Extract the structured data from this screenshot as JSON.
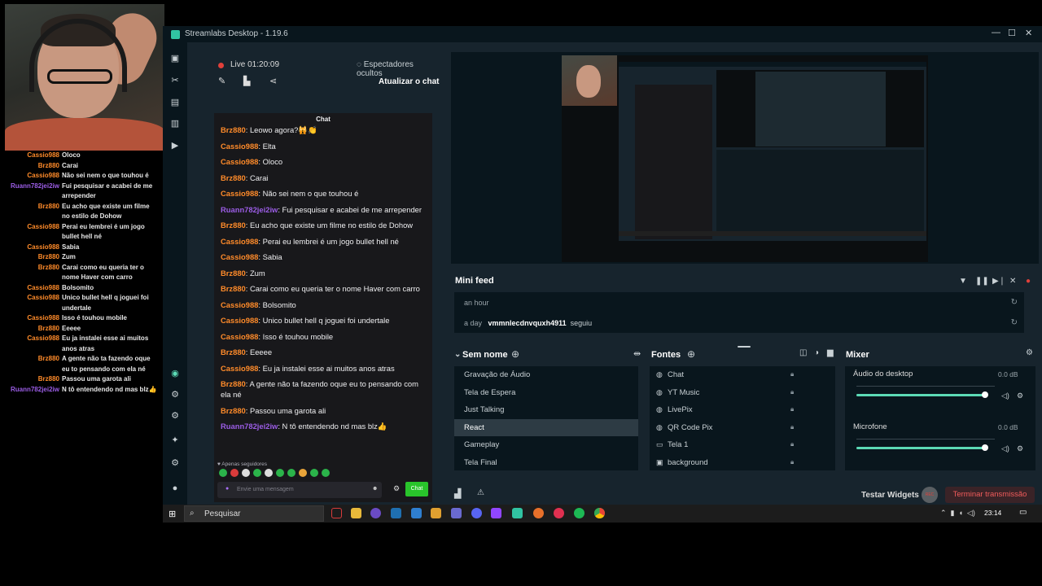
{
  "colors": {
    "bg": "#17242d",
    "dark": "#09161d",
    "accent": "#31c3a2",
    "live": "#e0403a",
    "send": "#29c42b",
    "username_orange": "#ff8b2a",
    "username_purple": "#9b5de5"
  },
  "window": {
    "title": "Streamlabs Desktop - 1.19.6",
    "minimize": "—",
    "maximize": "☐",
    "close": "✕"
  },
  "sidenav": [
    "window-icon",
    "tools-icon",
    "store-icon",
    "layout-icon",
    "play-icon",
    "theme-icon",
    "settings-icon",
    "account-icon"
  ],
  "live": {
    "status": "Live 01:20:09",
    "viewers_hidden": "Espectadores ocultos",
    "refresh_chat": "Atualizar o chat"
  },
  "chat": {
    "header": "Chat",
    "messages": [
      {
        "user": "Brz880",
        "text": ": Leowo agora?🙀👏",
        "color": "orange"
      },
      {
        "user": "Cassio988",
        "text": ": Elta",
        "color": "orange"
      },
      {
        "user": "Cassio988",
        "text": ": Oloco",
        "color": "orange"
      },
      {
        "user": "Brz880",
        "text": ": Carai",
        "color": "orange"
      },
      {
        "user": "Cassio988",
        "text": ": Não sei nem o que touhou é",
        "color": "orange"
      },
      {
        "user": "Ruann782jei2iw",
        "text": ": Fui pesquisar e acabei de me arrepender",
        "color": "purple"
      },
      {
        "user": "Brz880",
        "text": ": Eu acho que existe um filme no estilo de Dohow",
        "color": "orange"
      },
      {
        "user": "Cassio988",
        "text": ": Perai eu lembrei é um jogo bullet hell né",
        "color": "orange"
      },
      {
        "user": "Cassio988",
        "text": ": Sabia",
        "color": "orange"
      },
      {
        "user": "Brz880",
        "text": ": Zum",
        "color": "orange"
      },
      {
        "user": "Brz880",
        "text": ": Carai como eu queria ter o nome Haver com carro",
        "color": "orange"
      },
      {
        "user": "Cassio988",
        "text": ": Bolsomito",
        "color": "orange"
      },
      {
        "user": "Cassio988",
        "text": ": Unico bullet hell q joguei foi undertale",
        "color": "orange"
      },
      {
        "user": "Cassio988",
        "text": ": Isso é touhou mobile",
        "color": "orange"
      },
      {
        "user": "Brz880",
        "text": ": Eeeee",
        "color": "orange"
      },
      {
        "user": "Cassio988",
        "text": ": Eu ja instalei esse ai muitos anos atras",
        "color": "orange"
      },
      {
        "user": "Brz880",
        "text": ": A gente não ta fazendo oque eu to pensando com ela né",
        "color": "orange"
      },
      {
        "user": "Brz880",
        "text": ": Passou uma garota ali",
        "color": "orange"
      },
      {
        "user": "Ruann782jei2iw",
        "text": ": N tô entendendo nd mas blz👍",
        "color": "purple"
      }
    ],
    "followers_only": "♥ Apenas seguidores",
    "input_placeholder": "Envie uma mensagem",
    "send": "Chat"
  },
  "overlay_chat": [
    {
      "user": "Cassio988",
      "text": "Oloco",
      "color": "orange"
    },
    {
      "user": "Brz880",
      "text": "Carai",
      "color": "orange"
    },
    {
      "user": "Cassio988",
      "text": "Não sei nem o que touhou é",
      "color": "orange"
    },
    {
      "user": "Ruann782jei2iw",
      "text": "Fui pesquisar e acabei de me arrepender",
      "color": "purple"
    },
    {
      "user": "Brz880",
      "text": "Eu acho que existe um filme no estilo de Dohow",
      "color": "orange"
    },
    {
      "user": "Cassio988",
      "text": "Perai eu lembrei é um jogo bullet hell né",
      "color": "orange"
    },
    {
      "user": "Cassio988",
      "text": "Sabia",
      "color": "orange"
    },
    {
      "user": "Brz880",
      "text": "Zum",
      "color": "orange"
    },
    {
      "user": "Brz880",
      "text": "Carai como eu queria ter o nome Haver com carro",
      "color": "orange"
    },
    {
      "user": "Cassio988",
      "text": "Bolsomito",
      "color": "orange"
    },
    {
      "user": "Cassio988",
      "text": "Unico bullet hell q joguei foi undertale",
      "color": "orange"
    },
    {
      "user": "Cassio988",
      "text": "Isso é touhou mobile",
      "color": "orange"
    },
    {
      "user": "Brz880",
      "text": "Eeeee",
      "color": "orange"
    },
    {
      "user": "Cassio988",
      "text": "Eu ja instalei esse ai muitos anos atras",
      "color": "orange"
    },
    {
      "user": "Brz880",
      "text": "A gente não ta fazendo oque eu to pensando com ela né",
      "color": "orange"
    },
    {
      "user": "Brz880",
      "text": "Passou uma garota ali",
      "color": "orange"
    },
    {
      "user": "Ruann782jei2iw",
      "text": "N tô entendendo nd mas blz👍",
      "color": "purple"
    }
  ],
  "minifeed": {
    "title": "Mini feed",
    "rows": [
      {
        "time": "an hour",
        "user": "",
        "action": ""
      },
      {
        "time": "a day",
        "user": "vmmnlecdnvquxh4911",
        "action": "seguiu"
      }
    ]
  },
  "scenes": {
    "title": "Sem nome",
    "items": [
      "Gravação de Áudio",
      "Tela de Espera",
      "Just Talking",
      "React",
      "Gameplay",
      "Tela Final"
    ],
    "active": "React"
  },
  "sources": {
    "title": "Fontes",
    "items": [
      {
        "name": "Chat",
        "icon": "browser-icon"
      },
      {
        "name": "YT Music",
        "icon": "browser-icon"
      },
      {
        "name": "LivePix",
        "icon": "browser-icon"
      },
      {
        "name": "QR Code Pix",
        "icon": "browser-icon"
      },
      {
        "name": "Tela 1",
        "icon": "monitor-icon"
      },
      {
        "name": "background",
        "icon": "image-icon"
      }
    ]
  },
  "mixer": {
    "title": "Mixer",
    "channels": [
      {
        "name": "Áudio do desktop",
        "db": "0.0 dB",
        "level": 0.95
      },
      {
        "name": "Microfone",
        "db": "0.0 dB",
        "level": 0.95
      }
    ]
  },
  "footer": {
    "test_widgets": "Testar Widgets",
    "rec": "REC",
    "end_stream": "Terminar transmissão"
  },
  "taskbar": {
    "search": "Pesquisar",
    "clock": "23:14"
  }
}
